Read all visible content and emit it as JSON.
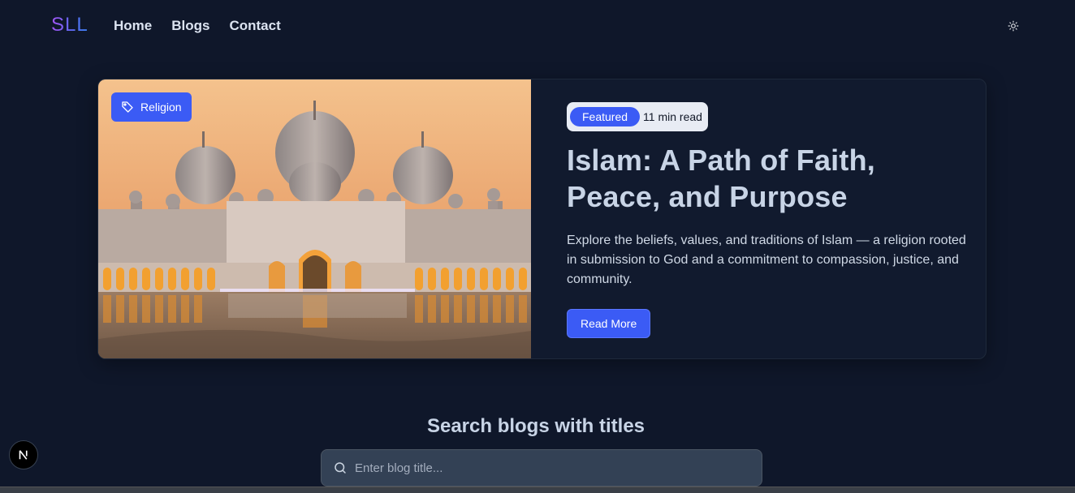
{
  "brand": {
    "logo": "SLL"
  },
  "nav": {
    "links": [
      {
        "label": "Home"
      },
      {
        "label": "Blogs"
      },
      {
        "label": "Contact"
      }
    ],
    "theme_icon": "sun-icon"
  },
  "featured_post": {
    "category": "Religion",
    "category_icon": "tag-icon",
    "badge": "Featured",
    "read_time": "11 min read",
    "title": "Islam: A Path of Faith, Peace, and Purpose",
    "description": "Explore the beliefs, values, and traditions of Islam — a religion rooted in submission to God and a commitment to compassion, justice, and community.",
    "cta_label": "Read More"
  },
  "search": {
    "heading": "Search blogs with titles",
    "placeholder": "Enter blog title..."
  },
  "dev_badge": {
    "letter": "N"
  },
  "colors": {
    "background": "#0f172a",
    "accent": "#3b5bf5",
    "card": "#111a2e",
    "input": "#334155"
  }
}
